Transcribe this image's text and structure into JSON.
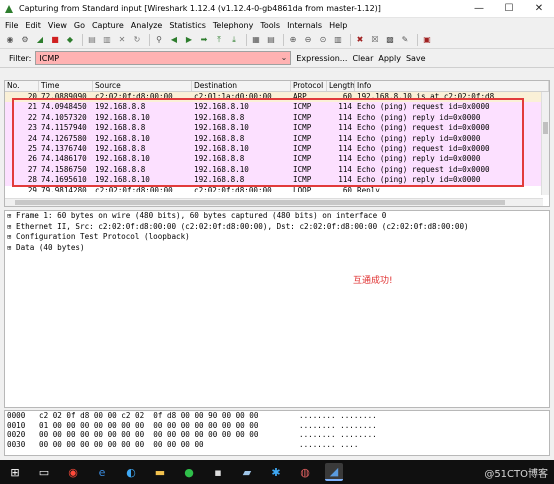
{
  "window": {
    "title": "Capturing from Standard input   [Wireshark 1.12.4  (v1.12.4-0-gb4861da from master-1.12)]"
  },
  "menu": [
    "File",
    "Edit",
    "View",
    "Go",
    "Capture",
    "Analyze",
    "Statistics",
    "Telephony",
    "Tools",
    "Internals",
    "Help"
  ],
  "filter": {
    "label": "Filter:",
    "value": "ICMP",
    "actions": [
      "Expression...",
      "Clear",
      "Apply",
      "Save"
    ],
    "background_color": "#ffb2b2"
  },
  "packet_list": {
    "columns": [
      "No.",
      "Time",
      "Source",
      "Destination",
      "Protocol",
      "Length",
      "Info"
    ],
    "rows": [
      {
        "no": "20",
        "time": "72.0889090",
        "src": "c2:02:0f:d8:00:00",
        "dst": "c2:01:1a:d0:00:00",
        "proto": "ARP",
        "len": "60",
        "info": "192.168.8.10 is at c2:02:0f:d8",
        "last": "",
        "kind": "arp"
      },
      {
        "no": "21",
        "time": "74.0948450",
        "src": "192.168.8.8",
        "dst": "192.168.8.10",
        "proto": "ICMP",
        "len": "114",
        "info": "Echo (ping) request  id=0x0000",
        "last": "s",
        "kind": "icmp"
      },
      {
        "no": "22",
        "time": "74.1057320",
        "src": "192.168.8.10",
        "dst": "192.168.8.8",
        "proto": "ICMP",
        "len": "114",
        "info": "Echo (ping) reply    id=0x0000",
        "last": "s",
        "kind": "icmp"
      },
      {
        "no": "23",
        "time": "74.1157940",
        "src": "192.168.8.8",
        "dst": "192.168.8.10",
        "proto": "ICMP",
        "len": "114",
        "info": "Echo (ping) request  id=0x0000",
        "last": "s",
        "kind": "icmp"
      },
      {
        "no": "24",
        "time": "74.1267580",
        "src": "192.168.8.10",
        "dst": "192.168.8.8",
        "proto": "ICMP",
        "len": "114",
        "info": "Echo (ping) reply    id=0x0000",
        "last": "s",
        "kind": "icmp"
      },
      {
        "no": "25",
        "time": "74.1376740",
        "src": "192.168.8.8",
        "dst": "192.168.8.10",
        "proto": "ICMP",
        "len": "114",
        "info": "Echo (ping) request  id=0x0000",
        "last": "s",
        "kind": "icmp"
      },
      {
        "no": "26",
        "time": "74.1486170",
        "src": "192.168.8.10",
        "dst": "192.168.8.8",
        "proto": "ICMP",
        "len": "114",
        "info": "Echo (ping) reply    id=0x0000",
        "last": "s",
        "kind": "icmp"
      },
      {
        "no": "27",
        "time": "74.1586750",
        "src": "192.168.8.8",
        "dst": "192.168.8.10",
        "proto": "ICMP",
        "len": "114",
        "info": "Echo (ping) request  id=0x0000",
        "last": "s",
        "kind": "icmp"
      },
      {
        "no": "28",
        "time": "74.1695610",
        "src": "192.168.8.10",
        "dst": "192.168.8.8",
        "proto": "ICMP",
        "len": "114",
        "info": "Echo (ping) reply    id=0x0000",
        "last": "s",
        "kind": "icmp"
      },
      {
        "no": "29",
        "time": "79.9814280",
        "src": "c2:02:0f:d8:00:00",
        "dst": "c2:02:0f:d8:00:00",
        "proto": "LOOP",
        "len": "60",
        "info": "Reply",
        "last": "",
        "kind": "loop"
      }
    ],
    "row_colors": {
      "arp": "#faf0d7",
      "icmp": "#fce0ff",
      "loop": "#ffffff"
    },
    "highlight_color": "#e23b3b"
  },
  "details": {
    "rows": [
      "Frame 1: 60 bytes on wire (480 bits), 60 bytes captured (480 bits) on interface 0",
      "Ethernet II, Src: c2:02:0f:d8:00:00 (c2:02:0f:d8:00:00), Dst: c2:02:0f:d8:00:00 (c2:02:0f:d8:00:00)",
      "Configuration Test Protocol (loopback)",
      "Data (40 bytes)"
    ],
    "annotation": "互通成功!"
  },
  "hex": {
    "rows": [
      {
        "offset": "0000",
        "bytes": "c2 02 0f d8 00 00 c2 02  0f d8 00 00 90 00 00 00",
        "ascii": "........ ........"
      },
      {
        "offset": "0010",
        "bytes": "01 00 00 00 00 00 00 00  00 00 00 00 00 00 00 00",
        "ascii": "........ ........"
      },
      {
        "offset": "0020",
        "bytes": "00 00 00 00 00 00 00 00  00 00 00 00 00 00 00 00",
        "ascii": "........ ........"
      },
      {
        "offset": "0030",
        "bytes": "00 00 00 00 00 00 00 00  00 00 00 00",
        "ascii": "........ ...."
      }
    ]
  },
  "taskbar": {
    "icons": [
      "start-icon",
      "task-view-icon",
      "browser-icon",
      "edge-icon",
      "search-app-icon",
      "folder-icon",
      "wechat-icon",
      "terminal-icon",
      "notes-icon",
      "star-app-icon",
      "media-icon",
      "wireshark-icon"
    ],
    "watermark": "@51CTO博客"
  },
  "colors": {
    "title_accent": "#2d7d2d",
    "chrome": "#f0f0f0",
    "taskbar": "#101010"
  }
}
